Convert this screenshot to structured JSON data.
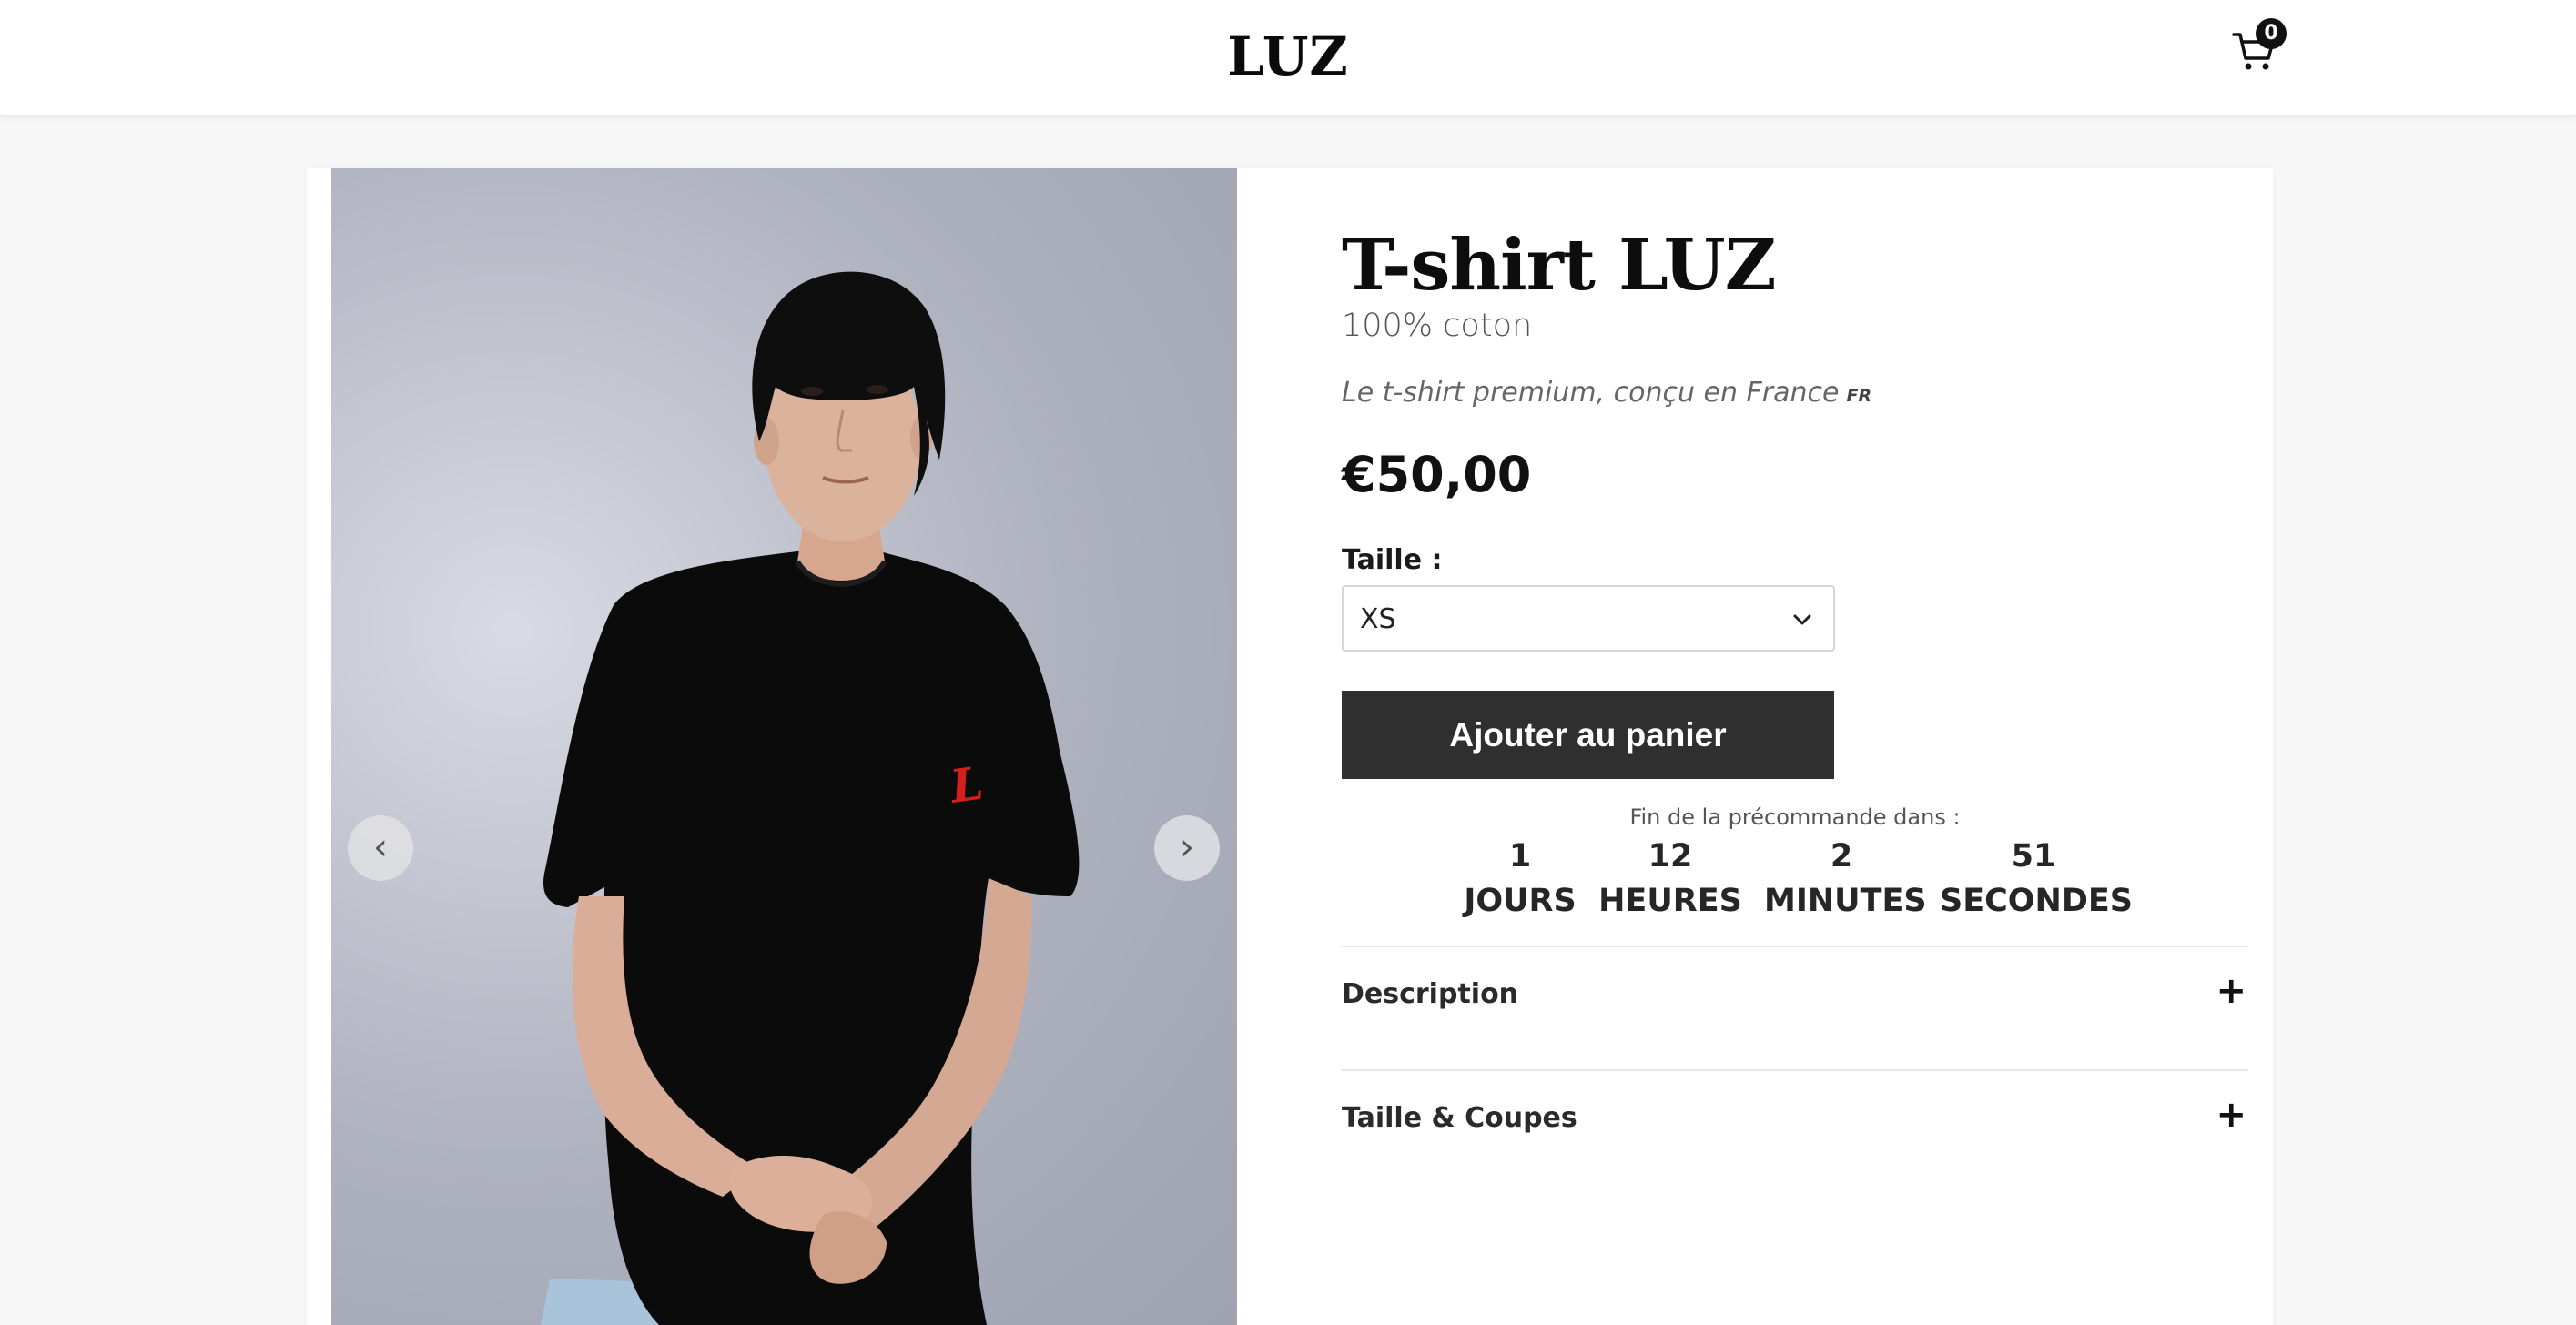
{
  "header": {
    "logo": "LUZ",
    "cart_icon": "cart-icon",
    "cart_count": "0"
  },
  "gallery": {
    "prev_icon": "chevron-left-icon",
    "next_icon": "chevron-right-icon",
    "prev_label": "‹",
    "next_label": "›",
    "shirt_logo_text": "L"
  },
  "product": {
    "title": "T-shirt LUZ",
    "subtitle": "100% coton",
    "tagline": "Le t-shirt premium, conçu en France",
    "flag": "FR",
    "price": "€50,00",
    "size_label": "Taille :",
    "size_value": "XS",
    "size_chevron_icon": "chevron-down-icon",
    "add_to_cart": "Ajouter au panier"
  },
  "countdown": {
    "label": "Fin de la précommande dans :",
    "items": [
      {
        "value": "1",
        "unit": "JOURS"
      },
      {
        "value": "12",
        "unit": "HEURES"
      },
      {
        "value": "2",
        "unit": "MINUTES"
      },
      {
        "value": "51",
        "unit": "SECONDES"
      }
    ]
  },
  "accordions": [
    {
      "label": "Description",
      "icon": "+"
    },
    {
      "label": "Taille & Coupes",
      "icon": "+"
    }
  ],
  "colors": {
    "accent_button": "#2f2f2f",
    "shirt_logo": "#d4201c",
    "background": "#f7f7f7"
  }
}
